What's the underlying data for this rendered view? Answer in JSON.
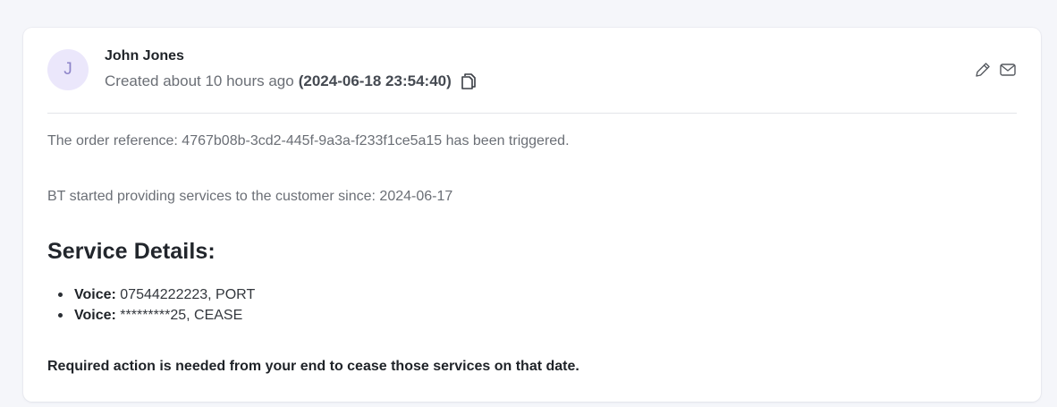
{
  "note": {
    "author_initial": "J",
    "author_name": "John Jones",
    "created_relative": "Created about 10 hours ago",
    "created_timestamp": "(2024-06-18 23:54:40)",
    "icons": {
      "copy": "copy-icon",
      "edit": "pencil-icon",
      "email": "mail-icon"
    },
    "colors": {
      "avatar_bg": "#ebe7fb",
      "avatar_text": "#8d84c9"
    }
  },
  "content": {
    "paragraph_1": "The order reference: 4767b08b-3cd2-445f-9a3a-f233f1ce5a15 has been triggered.",
    "paragraph_2": "BT started providing services to the customer since: 2024-06-17",
    "heading": "Service Details:",
    "services": [
      {
        "label": "Voice:",
        "value": "07544222223, PORT"
      },
      {
        "label": "Voice:",
        "value": "*********25, CEASE"
      }
    ],
    "action_note": "Required action is needed from your end to cease those services on that date."
  }
}
